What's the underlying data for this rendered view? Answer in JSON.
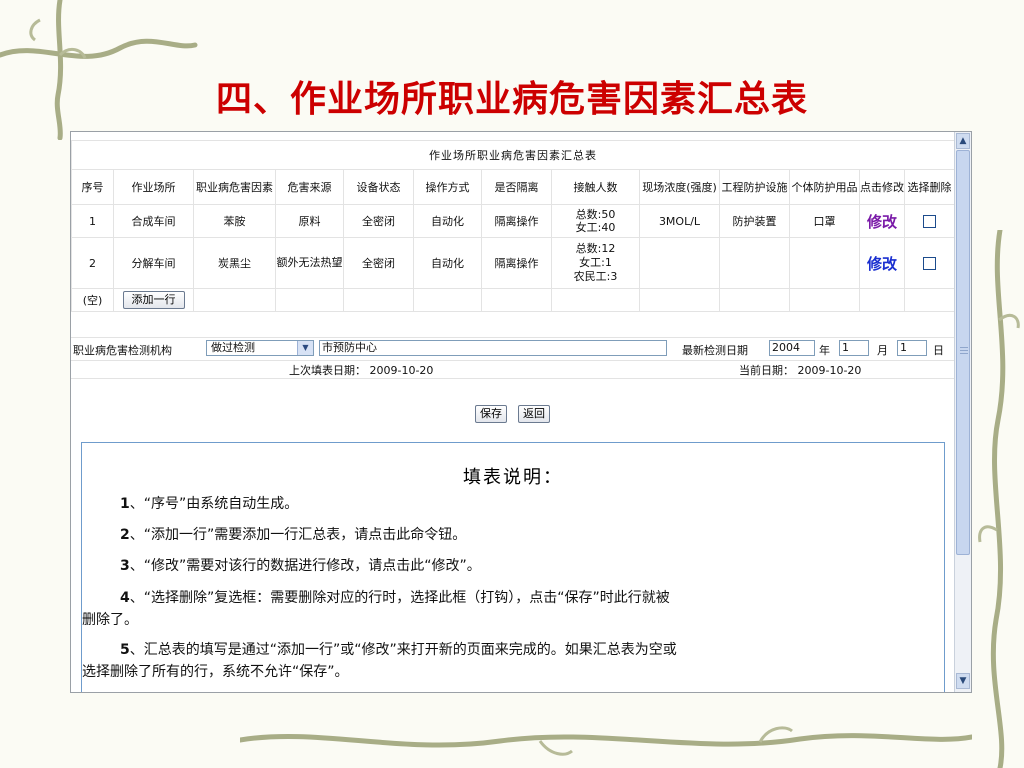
{
  "slide": {
    "title": "四、作业场所职业病危害因素汇总表"
  },
  "table": {
    "caption": "作业场所职业病危害因素汇总表",
    "headers": [
      "序号",
      "作业场所",
      "职业病危害因素",
      "危害来源",
      "设备状态",
      "操作方式",
      "是否隔离",
      "接触人数",
      "现场浓度(强度)",
      "工程防护设施",
      "个体防护用品",
      "点击修改",
      "选择删除"
    ],
    "rows": [
      {
        "no": "1",
        "place": "合成车间",
        "factor": "苯胺",
        "source": "原料",
        "equip": "全密闭",
        "op": "自动化",
        "isolation": "隔离操作",
        "contacts": [
          "总数:50",
          "女工:40"
        ],
        "conc": "3MOL/L",
        "eng": "防护装置",
        "ppe": "口罩",
        "edit": "修改"
      },
      {
        "no": "2",
        "place": "分解车间",
        "factor": "炭黑尘",
        "source": "额外无法热望",
        "equip": "全密闭",
        "op": "自动化",
        "isolation": "隔离操作",
        "contacts": [
          "总数:12",
          "女工:1",
          "农民工:3"
        ],
        "conc": "",
        "eng": "",
        "ppe": "",
        "edit": "修改"
      }
    ],
    "empty_label": "(空)",
    "add_row_button": "添加一行"
  },
  "detection": {
    "org_label": "职业病危害检测机构",
    "status_select": "做过检测",
    "org_value": "市预防中心",
    "latest_date_label": "最新检测日期",
    "year": "2004",
    "year_unit": "年",
    "month": "1",
    "month_unit": "月",
    "day": "1",
    "day_unit": "日"
  },
  "dates": {
    "last_fill_label": "上次填表日期：",
    "last_fill_value": "2009-10-20",
    "current_label": "当前日期：",
    "current_value": "2009-10-20"
  },
  "actions": {
    "save": "保存",
    "back": "返回"
  },
  "help": {
    "title": "填表说明：",
    "items": [
      {
        "num": "1",
        "text": "、“序号”由系统自动生成。"
      },
      {
        "num": "2",
        "text": "、“添加一行”需要添加一行汇总表，请点击此命令钮。"
      },
      {
        "num": "3",
        "text": "、“修改”需要对该行的数据进行修改，请点击此“修改”。"
      },
      {
        "num": "4",
        "text": "、“选择删除”复选框：需要删除对应的行时，选择此框（打钩），点击“保存”时此行就被",
        "cont": "删除了。"
      },
      {
        "num": "5",
        "text": "、汇总表的填写是通过“添加一行”或“修改”来打开新的页面来完成的。如果汇总表为空或",
        "cont": "选择删除了所有的行，系统不允许“保存”。"
      }
    ]
  },
  "colors": {
    "title_red": "#cc0000",
    "link_blue": "#1a2fd0",
    "link_visited": "#7a1aa8",
    "help_border": "#6f9ccc"
  },
  "icons": [
    "vine-decoration",
    "scroll-up-icon",
    "scroll-down-icon",
    "dropdown-arrow-icon",
    "checkbox"
  ]
}
